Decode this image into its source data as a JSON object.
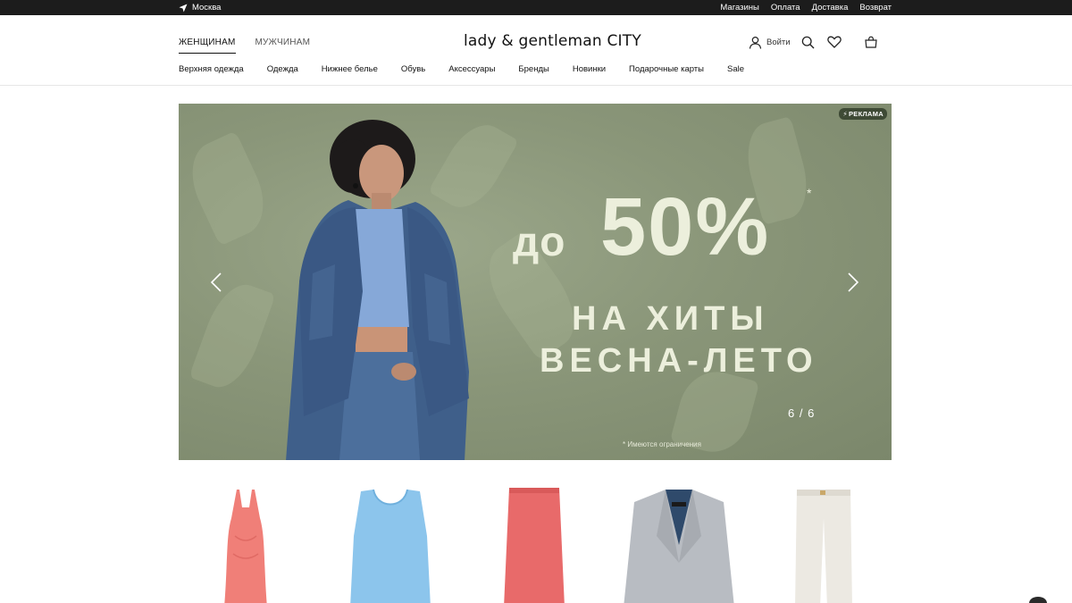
{
  "topbar": {
    "city": "Москва",
    "links": [
      "Магазины",
      "Оплата",
      "Доставка",
      "Возврат"
    ]
  },
  "header": {
    "gender_tabs": [
      {
        "label": "ЖЕНЩИНАМ",
        "active": true
      },
      {
        "label": "МУЖЧИНАМ",
        "active": false
      }
    ],
    "logo": "lady & gentleman CITY",
    "login_label": "Войти",
    "icons": [
      "user-icon",
      "search-icon",
      "heart-icon",
      "bag-icon"
    ]
  },
  "nav": {
    "categories": [
      "Верхняя одежда",
      "Одежда",
      "Нижнее белье",
      "Обувь",
      "Аксессуары",
      "Бренды",
      "Новинки",
      "Подарочные карты",
      "Sale"
    ]
  },
  "hero": {
    "ad_badge": "РЕКЛАМА",
    "promo_prefix": "до",
    "promo_value": "50%",
    "promo_asterisk": "*",
    "promo_line1": "НА ХИТЫ",
    "promo_line2": "ВЕСНА-ЛЕТО",
    "slide_counter": "6 / 6",
    "disclaimer": "* Имеются ограничения",
    "background_color": "#8a9679",
    "text_color": "#ecefdc"
  },
  "products": [
    {
      "type": "dress",
      "color": "#f07f78"
    },
    {
      "type": "top",
      "color": "#8cc5ec"
    },
    {
      "type": "skirt",
      "color": "#e86a6a"
    },
    {
      "type": "blazer",
      "color": "#b8bcc2"
    },
    {
      "type": "trousers",
      "color": "#ece9e2"
    }
  ],
  "colors": {
    "topbar_bg": "#1c1c1c",
    "accent_dark": "#111111"
  }
}
